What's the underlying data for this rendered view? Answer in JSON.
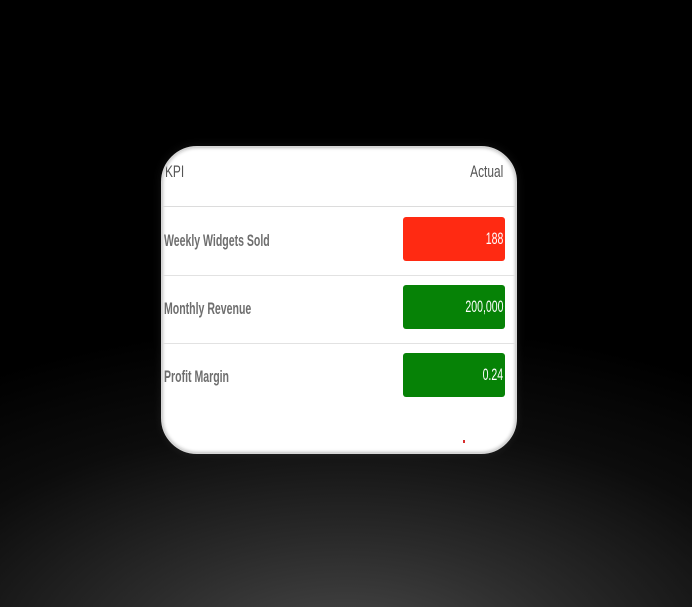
{
  "table": {
    "headers": {
      "kpi": "KPI",
      "actual": "Actual"
    },
    "rows": [
      {
        "label": "Weekly Widgets Sold",
        "value": "188",
        "status_color": "#ff2a12"
      },
      {
        "label": "Monthly Revenue",
        "value": "200,000",
        "status_color": "#068206"
      },
      {
        "label": "Profit Margin",
        "value": "0.24",
        "status_color": "#068206"
      }
    ]
  }
}
